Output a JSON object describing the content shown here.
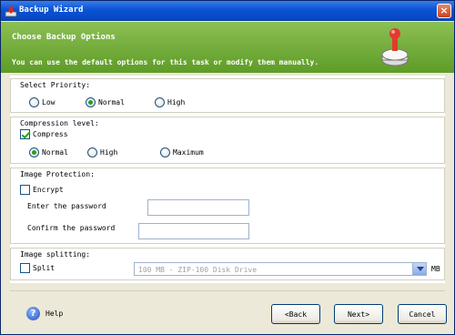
{
  "window": {
    "title": "Backup Wizard",
    "close_label": "×"
  },
  "banner": {
    "heading": "Choose Backup Options",
    "subtitle": "You can use the default options for this task or modify them manually."
  },
  "priority": {
    "caption": "Select Priority:",
    "options": [
      {
        "label": "Low",
        "selected": false
      },
      {
        "label": "Normal",
        "selected": true
      },
      {
        "label": "High",
        "selected": false
      }
    ]
  },
  "compression": {
    "caption": "Compression level:",
    "compress_label": "Compress",
    "compress_checked": true,
    "options": [
      {
        "label": "Normal",
        "selected": true
      },
      {
        "label": "High",
        "selected": false
      },
      {
        "label": "Maximum",
        "selected": false
      }
    ]
  },
  "protection": {
    "caption": "Image Protection:",
    "encrypt_label": "Encrypt",
    "encrypt_checked": false,
    "password_label": "Enter the password",
    "password_value": "",
    "confirm_label": "Confirm the password",
    "confirm_value": ""
  },
  "splitting": {
    "caption": "Image splitting:",
    "split_label": "Split",
    "split_checked": false,
    "size_value": "100 MB - ZIP-100 Disk Drive",
    "unit": "MB"
  },
  "footer": {
    "help_label": "Help",
    "back_label": "<Back",
    "next_label": "Next>",
    "cancel_label": "Cancel"
  },
  "colors": {
    "title_bar": "#0a53d6",
    "banner": "#6aa531",
    "accent_green": "#21a121"
  }
}
